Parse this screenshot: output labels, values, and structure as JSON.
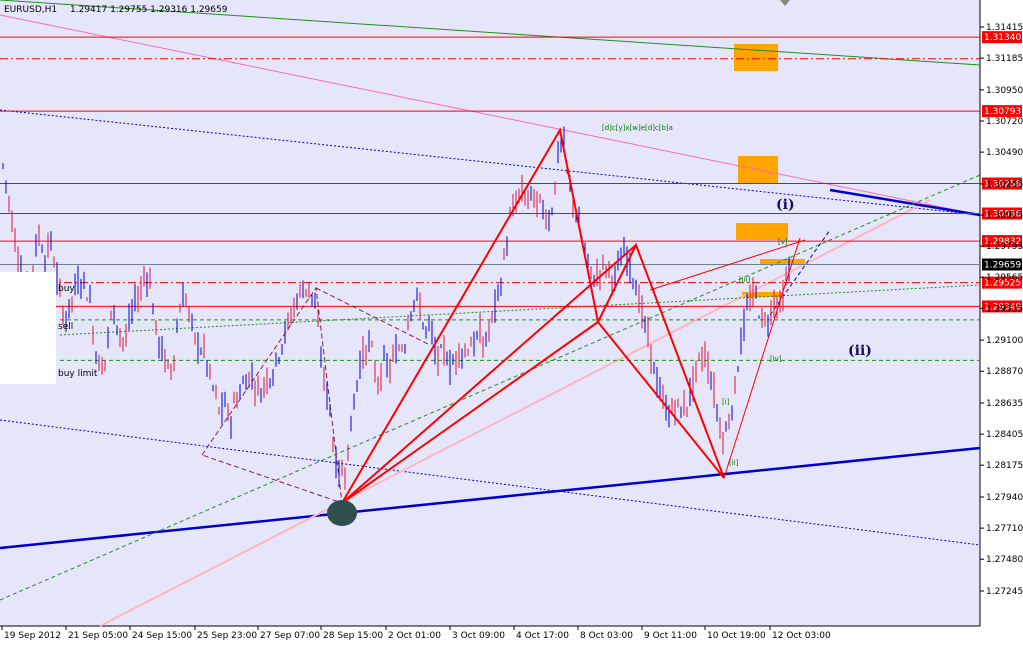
{
  "header": {
    "symbol": "EURUSD,H1",
    "quote": "1.29417 1.29755 1.29316 1.29659"
  },
  "orders": {
    "buy": "buy",
    "sell": "sell",
    "buy_limit": "buy limit"
  },
  "colors": {
    "background": "#E6E6FA",
    "bull_candle": "#0000CD",
    "bear_candle": "#DC143C",
    "resistance": "#FF0000",
    "trendline_blue": "#0000CD",
    "trendline_pink": "#FFB6C1",
    "trendline_green": "#228B22",
    "zone_orange": "#FFA500"
  },
  "wave_labels": {
    "top_series": "[d]c[y]x[w]e[d]c[b]a",
    "wave_i": "(i)",
    "wave_ii": "(ii)",
    "sub_v": "[v]",
    "sub_iii": "[iii]",
    "sub_iv": "[iv]",
    "sub_i": "[i]",
    "sub_ii": "[ii]"
  },
  "chart_data": {
    "type": "candlestick",
    "title": "EURUSD,H1",
    "xlabel": "",
    "ylabel": "",
    "ylim": [
      1.27135,
      1.31545
    ],
    "grid": false,
    "y_ticks": [
      "1.31415",
      "1.31185",
      "1.30950",
      "1.30720",
      "1.30490",
      "1.30255",
      "1.30025",
      "1.29795",
      "1.29565",
      "1.29335",
      "1.29100",
      "1.28870",
      "1.28635",
      "1.28405",
      "1.28175",
      "1.27940",
      "1.27710",
      "1.27480",
      "1.27245"
    ],
    "x_ticks": [
      "19 Sep 2012",
      "21 Sep 05:00",
      "24 Sep 15:00",
      "25 Sep 23:00",
      "27 Sep 07:00",
      "28 Sep 15:00",
      "2 Oct 01:00",
      "3 Oct 09:00",
      "4 Oct 17:00",
      "8 Oct 03:00",
      "9 Oct 11:00",
      "10 Oct 19:00",
      "12 Oct 03:00"
    ],
    "price_levels": [
      {
        "label": "1.31340",
        "value": 1.3134,
        "style": "solid"
      },
      {
        "label": "",
        "value": 1.3118,
        "style": "dashdot"
      },
      {
        "label": "1.30793",
        "value": 1.30793,
        "style": "solid"
      },
      {
        "label": "1.30258",
        "value": 1.30258,
        "style": "solid"
      },
      {
        "label": "1.30036",
        "value": 1.30036,
        "style": "solid"
      },
      {
        "label": "1.29832",
        "value": 1.29832,
        "style": "solid"
      },
      {
        "label": "1.29525",
        "value": 1.29525,
        "style": "dashdot"
      },
      {
        "label": "1.29349",
        "value": 1.29349,
        "style": "solid"
      }
    ],
    "current_price": "1.29659",
    "price_path": [
      [
        0,
        1.3049
      ],
      [
        5,
        1.3032
      ],
      [
        10,
        1.3008
      ],
      [
        15,
        1.2985
      ],
      [
        20,
        1.297
      ],
      [
        25,
        1.2945
      ],
      [
        30,
        1.2955
      ],
      [
        35,
        1.2975
      ],
      [
        40,
        1.299
      ],
      [
        45,
        1.2968
      ],
      [
        50,
        1.2985
      ],
      [
        55,
        1.2965
      ],
      [
        60,
        1.2942
      ],
      [
        65,
        1.2925
      ],
      [
        70,
        1.2935
      ],
      [
        75,
        1.2948
      ],
      [
        80,
        1.2955
      ],
      [
        85,
        1.2952
      ],
      [
        90,
        1.2938
      ],
      [
        95,
        1.2905
      ],
      [
        100,
        1.289
      ],
      [
        105,
        1.2895
      ],
      [
        110,
        1.2925
      ],
      [
        115,
        1.293
      ],
      [
        120,
        1.2915
      ],
      [
        125,
        1.2908
      ],
      [
        130,
        1.2925
      ],
      [
        135,
        1.2938
      ],
      [
        140,
        1.2945
      ],
      [
        145,
        1.296
      ],
      [
        150,
        1.2955
      ],
      [
        155,
        1.292
      ],
      [
        160,
        1.2905
      ],
      [
        165,
        1.2895
      ],
      [
        170,
        1.2885
      ],
      [
        175,
        1.2905
      ],
      [
        180,
        1.2935
      ],
      [
        185,
        1.2945
      ],
      [
        190,
        1.2925
      ],
      [
        195,
        1.291
      ],
      [
        200,
        1.2905
      ],
      [
        205,
        1.29
      ],
      [
        210,
        1.2882
      ],
      [
        215,
        1.287
      ],
      [
        220,
        1.2855
      ],
      [
        225,
        1.2862
      ],
      [
        230,
        1.285
      ],
      [
        235,
        1.2865
      ],
      [
        240,
        1.2872
      ],
      [
        245,
        1.288
      ],
      [
        250,
        1.2885
      ],
      [
        255,
        1.2878
      ],
      [
        260,
        1.287
      ],
      [
        265,
        1.288
      ],
      [
        270,
        1.2885
      ],
      [
        275,
        1.289
      ],
      [
        280,
        1.2905
      ],
      [
        285,
        1.2915
      ],
      [
        290,
        1.2925
      ],
      [
        295,
        1.2938
      ],
      [
        300,
        1.2945
      ],
      [
        305,
        1.295
      ],
      [
        310,
        1.2948
      ],
      [
        315,
        1.2935
      ],
      [
        320,
        1.2905
      ],
      [
        325,
        1.2875
      ],
      [
        330,
        1.286
      ],
      [
        335,
        1.282
      ],
      [
        340,
        1.281
      ],
      [
        345,
        1.2815
      ],
      [
        350,
        1.284
      ],
      [
        355,
        1.287
      ],
      [
        360,
        1.2895
      ],
      [
        365,
        1.29
      ],
      [
        370,
        1.291
      ],
      [
        375,
        1.2885
      ],
      [
        380,
        1.288
      ],
      [
        385,
        1.2895
      ],
      [
        390,
        1.2888
      ],
      [
        395,
        1.29
      ],
      [
        400,
        1.2905
      ],
      [
        405,
        1.291
      ],
      [
        410,
        1.2935
      ],
      [
        415,
        1.294
      ],
      [
        420,
        1.2935
      ],
      [
        425,
        1.2915
      ],
      [
        430,
        1.292
      ],
      [
        435,
        1.29
      ],
      [
        440,
        1.2895
      ],
      [
        445,
        1.2905
      ],
      [
        450,
        1.289
      ],
      [
        455,
        1.2895
      ],
      [
        460,
        1.2905
      ],
      [
        465,
        1.29
      ],
      [
        470,
        1.291
      ],
      [
        475,
        1.2905
      ],
      [
        480,
        1.2915
      ],
      [
        485,
        1.2905
      ],
      [
        490,
        1.292
      ],
      [
        495,
        1.2935
      ],
      [
        500,
        1.2948
      ],
      [
        505,
        1.2975
      ],
      [
        510,
        1.2998
      ],
      [
        515,
        1.301
      ],
      [
        520,
        1.302
      ],
      [
        525,
        1.3015
      ],
      [
        530,
        1.3018
      ],
      [
        535,
        1.3012
      ],
      [
        540,
        1.301
      ],
      [
        545,
        1.3005
      ],
      [
        550,
        1.2998
      ],
      [
        555,
        1.3025
      ],
      [
        560,
        1.306
      ],
      [
        565,
        1.305
      ],
      [
        570,
        1.302
      ],
      [
        575,
        1.3008
      ],
      [
        580,
        1.299
      ],
      [
        585,
        1.2975
      ],
      [
        590,
        1.296
      ],
      [
        595,
        1.2955
      ],
      [
        600,
        1.2962
      ],
      [
        605,
        1.2965
      ],
      [
        610,
        1.296
      ],
      [
        615,
        1.2955
      ],
      [
        620,
        1.2968
      ],
      [
        625,
        1.2975
      ],
      [
        630,
        1.2965
      ],
      [
        635,
        1.2955
      ],
      [
        640,
        1.2935
      ],
      [
        645,
        1.292
      ],
      [
        650,
        1.2905
      ],
      [
        655,
        1.2885
      ],
      [
        660,
        1.287
      ],
      [
        665,
        1.286
      ],
      [
        670,
        1.2855
      ],
      [
        675,
        1.2862
      ],
      [
        680,
        1.2858
      ],
      [
        685,
        1.286
      ],
      [
        690,
        1.287
      ],
      [
        695,
        1.2885
      ],
      [
        700,
        1.2895
      ],
      [
        705,
        1.29
      ],
      [
        710,
        1.2885
      ],
      [
        715,
        1.2868
      ],
      [
        720,
        1.2845
      ],
      [
        725,
        1.2838
      ],
      [
        730,
        1.2855
      ],
      [
        735,
        1.2875
      ],
      [
        740,
        1.2905
      ],
      [
        745,
        1.2925
      ],
      [
        750,
        1.294
      ],
      [
        755,
        1.2945
      ],
      [
        760,
        1.293
      ],
      [
        765,
        1.2922
      ],
      [
        770,
        1.293
      ],
      [
        775,
        1.2942
      ],
      [
        780,
        1.2935
      ],
      [
        785,
        1.2948
      ],
      [
        790,
        1.2966
      ]
    ]
  }
}
